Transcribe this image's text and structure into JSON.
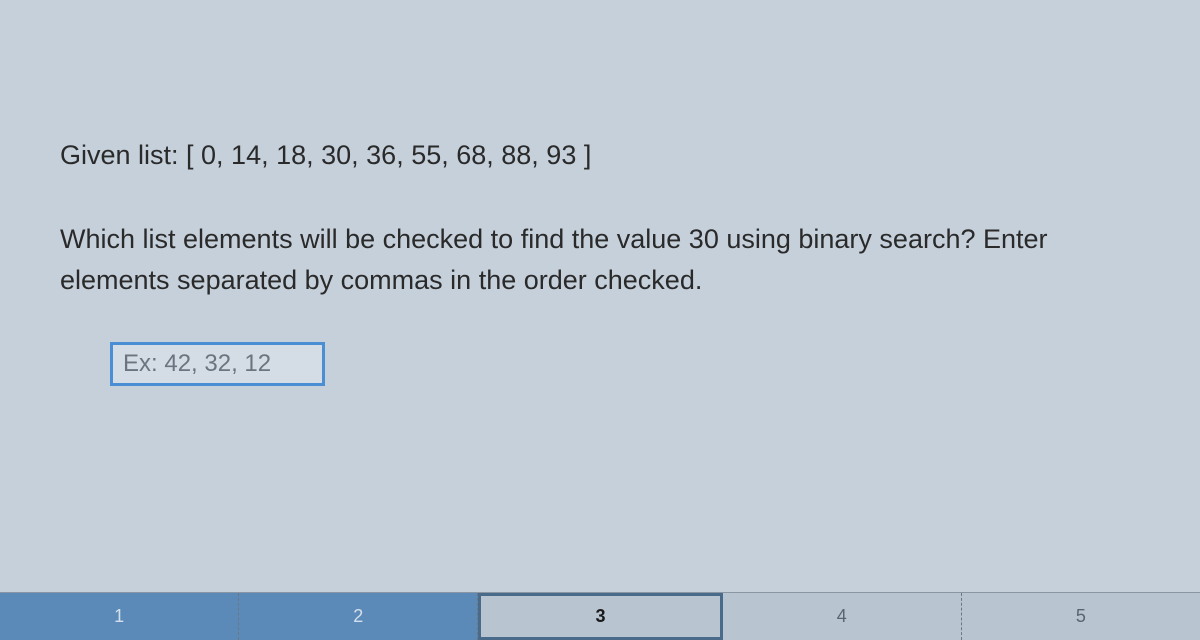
{
  "content": {
    "given_list_label": "Given list: [ 0, 14, 18, 30, 36, 55, 68, 88, 93 ]",
    "question": "Which list elements will be checked to find the value 30 using binary search? Enter elements separated by commas in the order checked.",
    "input_placeholder": "Ex: 42, 32, 12"
  },
  "progress": {
    "steps": [
      "1",
      "2",
      "3",
      "4",
      "5"
    ],
    "completed_count": 2,
    "current_index": 2
  }
}
